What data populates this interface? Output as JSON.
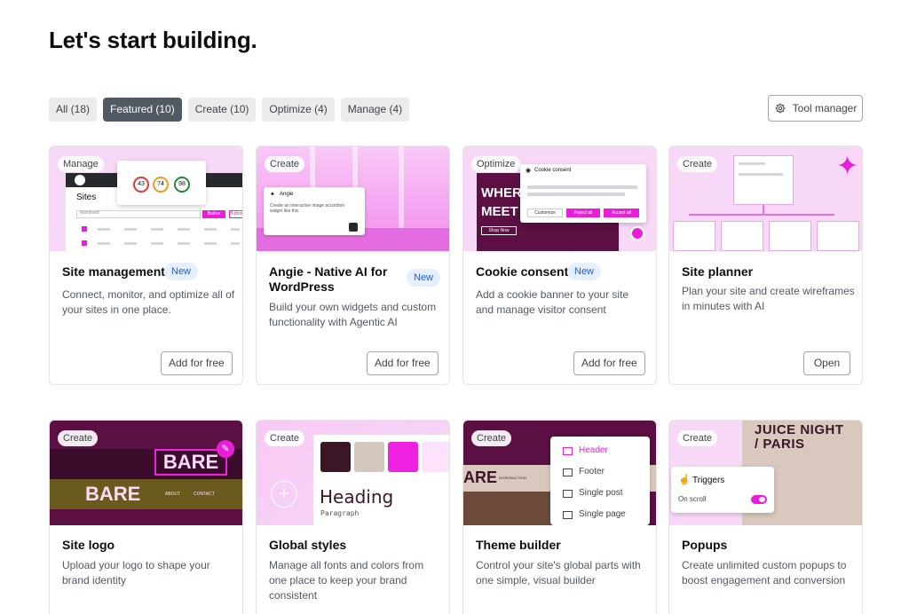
{
  "page_title": "Let's start building.",
  "tabs": [
    {
      "label": "All (18)",
      "active": false
    },
    {
      "label": "Featured (10)",
      "active": true
    },
    {
      "label": "Create (10)",
      "active": false
    },
    {
      "label": "Optimize (4)",
      "active": false
    },
    {
      "label": "Manage (4)",
      "active": false
    }
  ],
  "tool_manager": {
    "label": "Tool manager",
    "icon": "gear-icon"
  },
  "new_label": "New",
  "cards": [
    {
      "category": "Manage",
      "title": "Site management",
      "is_new": true,
      "description": "Connect, monitor, and optimize all of your sites in one place.",
      "button": "Add for free",
      "thumb": {
        "sites_label": "Sites",
        "scores": [
          "43",
          "74",
          "98"
        ],
        "search_text": "Wordrsed",
        "btn_a": "Button",
        "btn_b": "Button"
      }
    },
    {
      "category": "Create",
      "title": "Angie - Native AI for WordPress",
      "is_new": true,
      "description": "Build your own widgets and custom functionality with Agentic AI",
      "button": "Add for free",
      "thumb": {
        "name": "Angie",
        "prompt": "Create an interactive image accordion widget like this"
      }
    },
    {
      "category": "Optimize",
      "title": "Cookie consent",
      "is_new": true,
      "description": "Add a cookie banner to your site and manage visitor consent",
      "button": "Add for free",
      "thumb": {
        "heading": "WHER MEET",
        "dialog_title": "Cookie consent",
        "customize": "Customize",
        "reject": "Reject all",
        "accept": "Accept all",
        "shop": "Shop Now"
      }
    },
    {
      "category": "Create",
      "title": "Site planner",
      "is_new": false,
      "description": "Plan your site and create wireframes in minutes with AI",
      "button": "Open"
    },
    {
      "category": "Create",
      "title": "Site logo",
      "is_new": false,
      "description": "Upload your logo to shape your brand identity",
      "thumb": {
        "logo_text": "BARE",
        "about": "ABOUT",
        "contact": "CONTACT"
      }
    },
    {
      "category": "Create",
      "title": "Global styles",
      "is_new": false,
      "description": "Manage all fonts and colors from one place to keep your brand consistent",
      "thumb": {
        "heading": "Heading",
        "paragraph": "Paragraph",
        "swatches": [
          "#3a1626",
          "#d4c8be",
          "#ee22e0",
          "#fce3fb"
        ]
      }
    },
    {
      "category": "Create",
      "title": "Theme builder",
      "is_new": false,
      "description": "Control your site's global parts with one simple, visual builder",
      "thumb": {
        "menu": [
          "Header",
          "Footer",
          "Single post",
          "Single page"
        ],
        "partial": "ARE",
        "nav_text": "INTRODUCTION"
      }
    },
    {
      "category": "Create",
      "title": "Popups",
      "is_new": false,
      "description": "Create unlimited custom popups to boost engagement and conversion",
      "thumb": {
        "poster_line1": "JUICE NIGHT",
        "poster_line2": "/ PARIS",
        "triggers": "Triggers",
        "on_scroll": "On scroll"
      }
    }
  ],
  "colors": {
    "accent_magenta": "#e81ed8",
    "pink_bg": "#f7d9f7",
    "plum": "#5b0f42",
    "tab_active": "#515962",
    "new_pill_text": "#1a5bd6"
  }
}
